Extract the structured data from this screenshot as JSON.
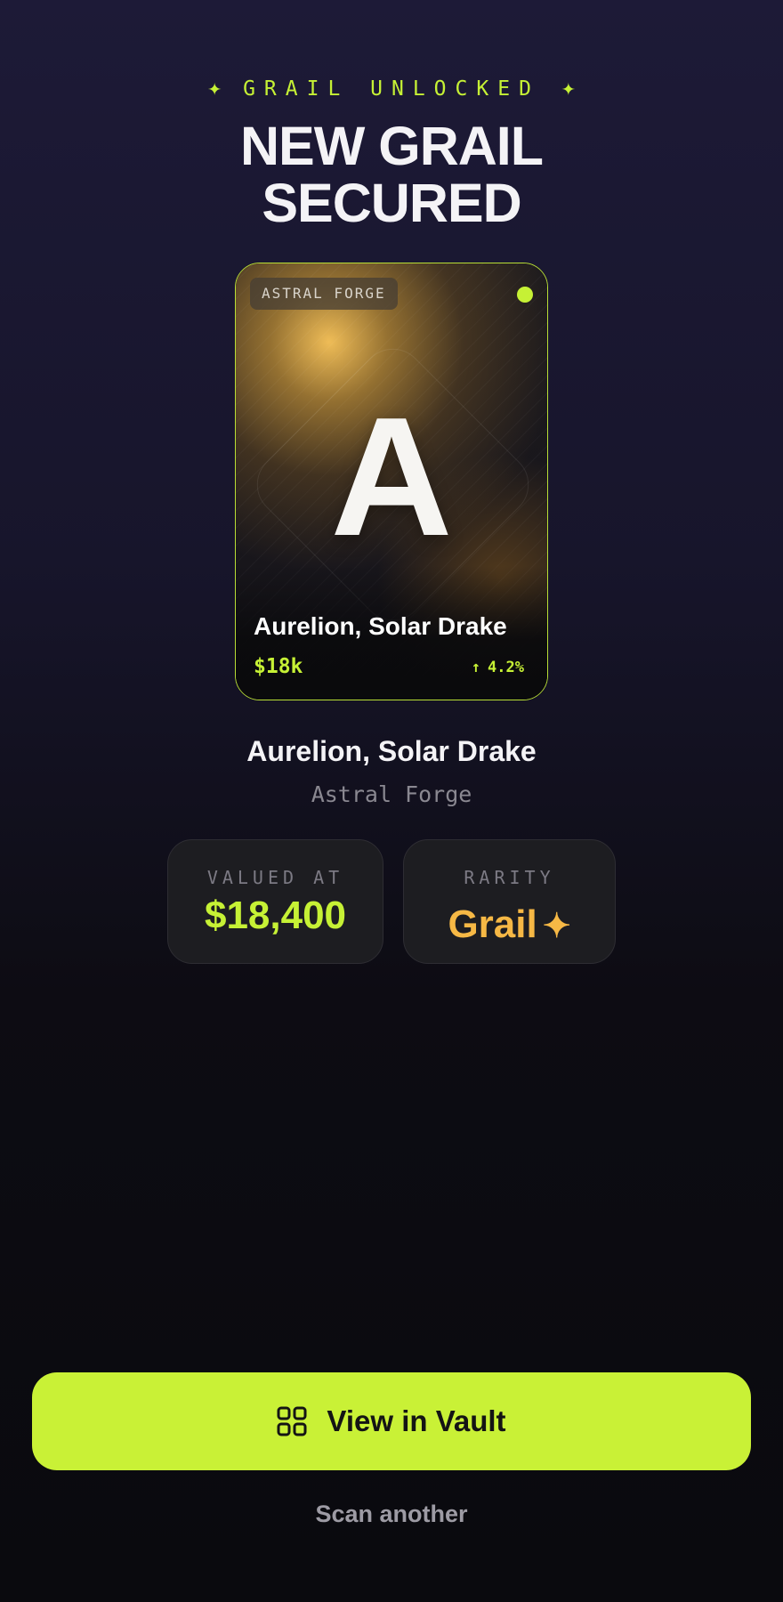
{
  "eyebrow": {
    "text": "GRAIL UNLOCKED",
    "star_glyph": "✦"
  },
  "headline": {
    "line1": "NEW GRAIL",
    "line2": "SECURED"
  },
  "card": {
    "set_tag": "ASTRAL FORGE",
    "letter": "A",
    "name": "Aurelion, Solar Drake",
    "price": "$18k",
    "change_arrow": "↑",
    "change": "4.2%",
    "status_dot_color": "#c6f135",
    "border_color": "#b8de35"
  },
  "item": {
    "name": "Aurelion, Solar Drake",
    "set": "Astral Forge"
  },
  "stats": {
    "value_label": "VALUED AT",
    "value": "$18,400",
    "rarity_label": "RARITY",
    "rarity": "Grail",
    "rarity_glyph": "✦"
  },
  "actions": {
    "primary_label": "View in Vault",
    "primary_icon": "grid-icon",
    "secondary_label": "Scan another"
  },
  "colors": {
    "accent": "#c6f135",
    "rarity": "#f6b845",
    "background_top": "#1d1a37",
    "background_bottom": "#0a0a0e"
  }
}
